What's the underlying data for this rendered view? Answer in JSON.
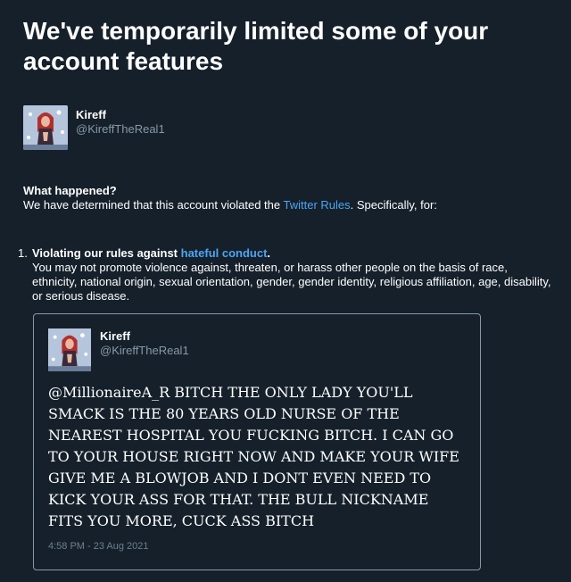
{
  "page": {
    "title": "We've temporarily limited some of your account features"
  },
  "account": {
    "display_name": "Kireff",
    "handle": "@KireffTheReal1",
    "avatar_icon": "profile-photo"
  },
  "what_happened": {
    "heading": "What happened?",
    "body_prefix": "We have determined that this account violated the ",
    "rules_link": "Twitter Rules",
    "body_suffix": ". Specifically, for:"
  },
  "violations": [
    {
      "number": "1.",
      "title_prefix": "Violating our rules against ",
      "title_link": "hateful conduct",
      "title_suffix": ".",
      "description": "You may not promote violence against, threaten, or harass other people on the basis of race, ethnicity, national origin, sexual orientation, gender, gender identity, religious affiliation, age, disability, or serious disease."
    }
  ],
  "tweet": {
    "display_name": "Kireff",
    "handle": "@KireffTheReal1",
    "text": "@MillionaireA_R BITCH THE ONLY LADY YOU'LL SMACK IS THE 80 YEARS OLD NURSE OF THE NEAREST HOSPITAL YOU FUCKING BITCH. I CAN GO TO YOUR HOUSE RIGHT NOW AND MAKE YOUR WIFE GIVE ME A BLOWJOB AND I DONT EVEN NEED TO KICK YOUR ASS FOR THAT. THE BULL NICKNAME FITS YOU MORE, CUCK ASS BITCH",
    "timestamp": "4:58 PM - 23 Aug 2021"
  },
  "colors": {
    "background": "#15202b",
    "link": "#4ea4f0",
    "secondary_text": "#8899a6"
  }
}
